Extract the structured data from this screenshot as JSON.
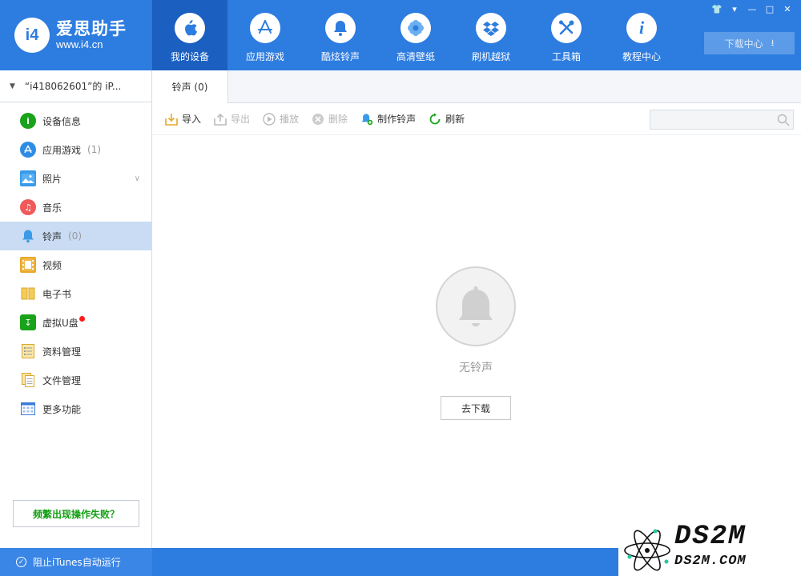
{
  "app": {
    "logo_name": "爱思助手",
    "logo_url": "www.i4.cn",
    "logo_mark": "i4"
  },
  "nav": {
    "tabs": [
      {
        "label": "我的设备",
        "icon": "apple-icon"
      },
      {
        "label": "应用游戏",
        "icon": "appstore-icon"
      },
      {
        "label": "酷炫铃声",
        "icon": "bell-icon"
      },
      {
        "label": "高清壁纸",
        "icon": "flower-icon"
      },
      {
        "label": "刷机越狱",
        "icon": "dropbox-icon"
      },
      {
        "label": "工具箱",
        "icon": "tools-icon"
      },
      {
        "label": "教程中心",
        "icon": "info-icon"
      }
    ],
    "active_index": 0,
    "download_center": "下载中心"
  },
  "sidebar": {
    "device": "“i418062601”的 iP...",
    "items": [
      {
        "label": "设备信息",
        "count": "",
        "icon": "info-circle-icon",
        "color": "#1aa31a"
      },
      {
        "label": "应用游戏",
        "count": "(1)",
        "icon": "appstore-icon",
        "color": "#2d8ce6"
      },
      {
        "label": "照片",
        "count": "",
        "icon": "photo-icon",
        "color": "#3a9ae8"
      },
      {
        "label": "音乐",
        "count": "",
        "icon": "music-icon",
        "color": "#f05a5a"
      },
      {
        "label": "铃声",
        "count": "(0)",
        "icon": "bell-icon",
        "color": "#3a9ae8"
      },
      {
        "label": "视频",
        "count": "",
        "icon": "film-icon",
        "color": "#e8a82a"
      },
      {
        "label": "电子书",
        "count": "",
        "icon": "book-icon",
        "color": "#f0c040"
      },
      {
        "label": "虚拟U盘",
        "count": "",
        "icon": "usb-icon",
        "color": "#1aa31a"
      },
      {
        "label": "资料管理",
        "count": "",
        "icon": "contacts-icon",
        "color": "#e8a82a"
      },
      {
        "label": "文件管理",
        "count": "",
        "icon": "files-icon",
        "color": "#e8a82a"
      },
      {
        "label": "更多功能",
        "count": "",
        "icon": "grid-icon",
        "color": "#3a7ad8"
      }
    ],
    "active_index": 4,
    "fail_button": "频繁出现操作失败？"
  },
  "content": {
    "tab_label": "铃声 (0)",
    "toolbar": {
      "import": "导入",
      "export": "导出",
      "play": "播放",
      "delete": "删除",
      "make": "制作铃声",
      "refresh": "刷新"
    },
    "search_placeholder": "",
    "empty_text": "无铃声",
    "go_download": "去下载"
  },
  "footer": {
    "itunes": "阻止iTunes自动运行"
  },
  "watermark": {
    "big": "DS2M",
    "small": "DS2M.COM"
  }
}
